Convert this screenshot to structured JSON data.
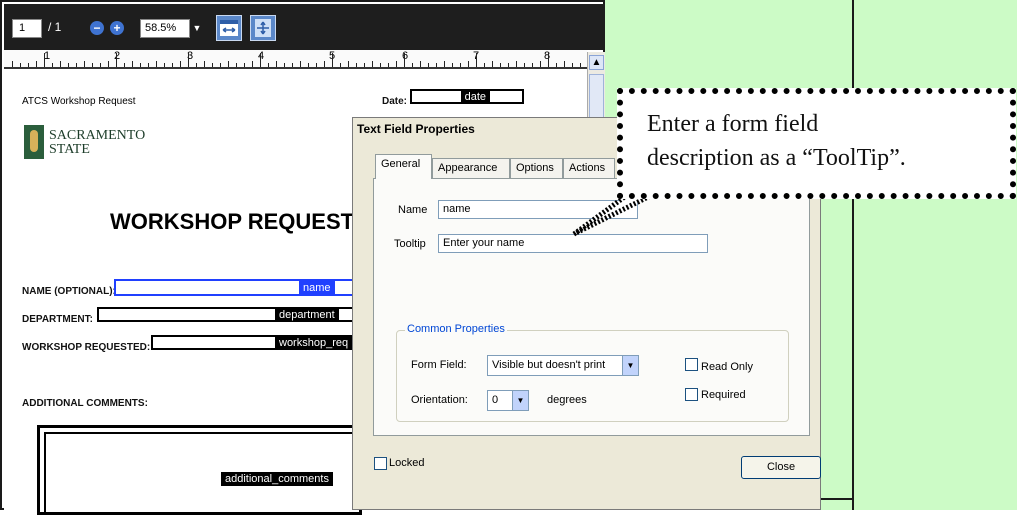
{
  "viewer": {
    "page_current": "1",
    "page_total": "/ 1",
    "zoom": "58.5%",
    "zoom_out_symbol": "−",
    "zoom_in_symbol": "+",
    "ruler_numbers": [
      "1",
      "2",
      "3",
      "4",
      "5",
      "6",
      "7",
      "8"
    ]
  },
  "document": {
    "header": "ATCS Workshop Request",
    "date_label": "Date:",
    "date_field": "date",
    "logo_line1": "SACRAMENTO",
    "logo_line2": "STATE",
    "heading": "WORKSHOP REQUEST",
    "name_label": "NAME (OPTIONAL):",
    "name_field": "name",
    "department_label": "DEPARTMENT:",
    "department_field": "department",
    "workshop_label": "WORKSHOP REQUESTED:",
    "workshop_field": "workshop_req",
    "comments_label": "ADDITIONAL COMMENTS:",
    "comments_field": "additional_comments"
  },
  "dialog": {
    "title": "Text Field Properties",
    "tabs": [
      "General",
      "Appearance",
      "Options",
      "Actions"
    ],
    "name_label": "Name",
    "name_value": "name",
    "tooltip_label": "Tooltip",
    "tooltip_value": "Enter your name",
    "group_title": "Common Properties",
    "form_field_label": "Form Field:",
    "form_field_value": "Visible but doesn't print",
    "orientation_label": "Orientation:",
    "orientation_value": "0",
    "degrees_label": "degrees",
    "read_only_label": "Read Only",
    "required_label": "Required",
    "locked_label": "Locked",
    "close_label": "Close"
  },
  "callout": {
    "line1": "Enter a form field",
    "line2": "description as a “ToolTip”."
  },
  "colors": {
    "callout_bg": "#ccfbc6",
    "toolbar_bg": "#1e1e1e",
    "dialog_bg": "#ece9d8",
    "group_title": "#0046d5"
  },
  "icons": {
    "zoom_out": "zoom-out-icon",
    "zoom_in": "zoom-in-icon",
    "fit_width": "fit-width-icon",
    "fit_page": "fit-page-icon",
    "dropdown": "chevron-down-icon"
  }
}
